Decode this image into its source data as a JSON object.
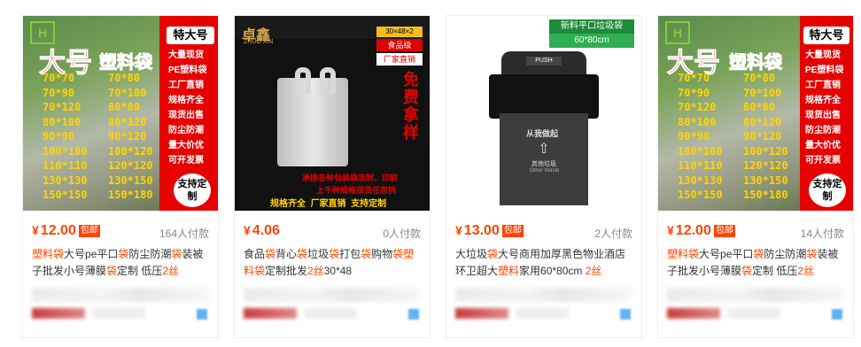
{
  "products": [
    {
      "price_currency": "¥",
      "price": "12.00",
      "badge": "包邮",
      "sold": "164人付款",
      "title_parts": [
        "塑料袋",
        "大号pe平口",
        "袋",
        "防尘防潮",
        "袋",
        "装被子批发小号薄膜",
        "袋",
        "定制 低压",
        "2丝"
      ],
      "image": {
        "big_title": "大号",
        "big_title2": "塑料袋",
        "corner": "特大号",
        "sizes_left": [
          "70*70",
          "70*90",
          "70*120",
          "80*100",
          "90*90",
          "100*100",
          "110*110",
          "130*130",
          "150*150"
        ],
        "sizes_right": [
          "70*80",
          "70*100",
          "80*80",
          "80*120",
          "90*120",
          "100*120",
          "120*120",
          "130*150",
          "150*180"
        ],
        "features": [
          "大量现货",
          "PE塑料袋",
          "工厂直销",
          "规格齐全",
          "现货出售",
          "防尘防潮",
          "量大价优",
          "可开发票"
        ],
        "custom": "支持定制"
      }
    },
    {
      "price_currency": "¥",
      "price": "4.06",
      "badge": "",
      "sold": "0人付款",
      "title_parts": [
        "食品",
        "袋",
        "背心",
        "袋",
        "垃圾",
        "袋",
        "打包",
        "袋",
        "购物",
        "袋",
        "",
        "塑料袋",
        "定制批发",
        "2丝",
        "30*48"
      ],
      "image": {
        "brand": "卓鑫",
        "brand_en": "ZHUO XIN",
        "tag1": "30×48×2",
        "tag2": "食品级",
        "tag3": "厂家直销",
        "free": "免费拿样",
        "line1": "承接各种包装袋定制、印刷",
        "line2": "上千种规格现货任您挑",
        "bottom": [
          "规格齐全",
          "厂家直销",
          "支持定制"
        ]
      }
    },
    {
      "price_currency": "¥",
      "price": "13.00",
      "badge": "包邮",
      "sold": "2人付款",
      "title_parts": [
        "大垃圾",
        "袋",
        "大号商用加厚黑色物业酒店环卫超大",
        "塑料",
        "家用60*80cm ",
        "2丝"
      ],
      "image": {
        "banner1": "新料平口垃圾袋",
        "banner2": "60*80cm",
        "lid": "PUSH",
        "slogan": "从我做起",
        "category": "其他垃圾",
        "category_en": "Other Waste"
      }
    },
    {
      "price_currency": "¥",
      "price": "12.00",
      "badge": "包邮",
      "sold": "14人付款",
      "title_parts": [
        "塑料袋",
        "大号pe平口",
        "袋",
        "防尘防潮",
        "袋",
        "装被子批发小号薄膜",
        "袋",
        "定制 低压",
        "2丝"
      ],
      "image": {
        "big_title": "大号",
        "big_title2": "塑料袋",
        "corner": "特大号",
        "sizes_left": [
          "70*70",
          "70*90",
          "70*120",
          "80*100",
          "90*90",
          "100*100",
          "110*110",
          "130*130",
          "150*150"
        ],
        "sizes_right": [
          "70*80",
          "70*100",
          "80*80",
          "80*120",
          "90*120",
          "100*120",
          "120*120",
          "130*150",
          "150*180"
        ],
        "features": [
          "大量现货",
          "PE塑料袋",
          "工厂直销",
          "规格齐全",
          "现货出售",
          "防尘防潮",
          "量大价优",
          "可开发票"
        ],
        "custom": "支持定制"
      }
    }
  ]
}
